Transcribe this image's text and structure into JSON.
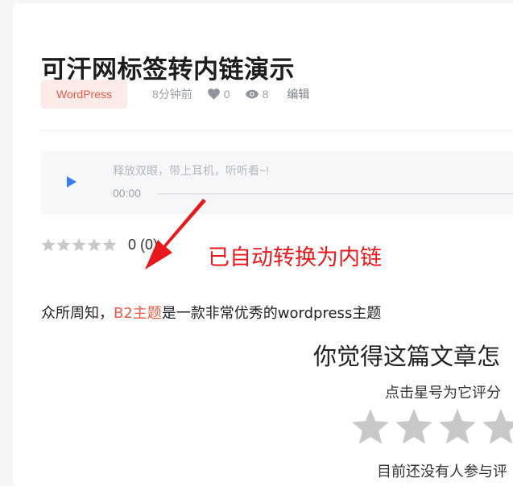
{
  "post": {
    "title": "可汗网标签转内链演示",
    "category": "WordPress",
    "time": "8分钟前",
    "likes": "0",
    "views": "8",
    "edit_label": "编辑"
  },
  "audio": {
    "tip": "释放双眼，带上耳机，听听看~!",
    "time": "00:00"
  },
  "rating": {
    "count_text": "0 (0)"
  },
  "annotation": {
    "text": "已自动转换为内链"
  },
  "content": {
    "prefix": "众所周知，",
    "link_text": "B2主题",
    "suffix": "是一款非常优秀的wordpress主题"
  },
  "vote": {
    "title": "你觉得这篇文章怎",
    "subtitle": "点击星号为它评分",
    "bottom_text": "目前还没有人参与评"
  },
  "colors": {
    "accent": "#e85b4a",
    "play": "#3b7ff0",
    "star_empty": "#c8c8c8",
    "annotation": "#e8191c"
  },
  "icons": {
    "likes": "heart-icon",
    "views": "eye-icon",
    "play": "play-icon",
    "star": "star-icon",
    "arrow": "arrow-icon"
  }
}
